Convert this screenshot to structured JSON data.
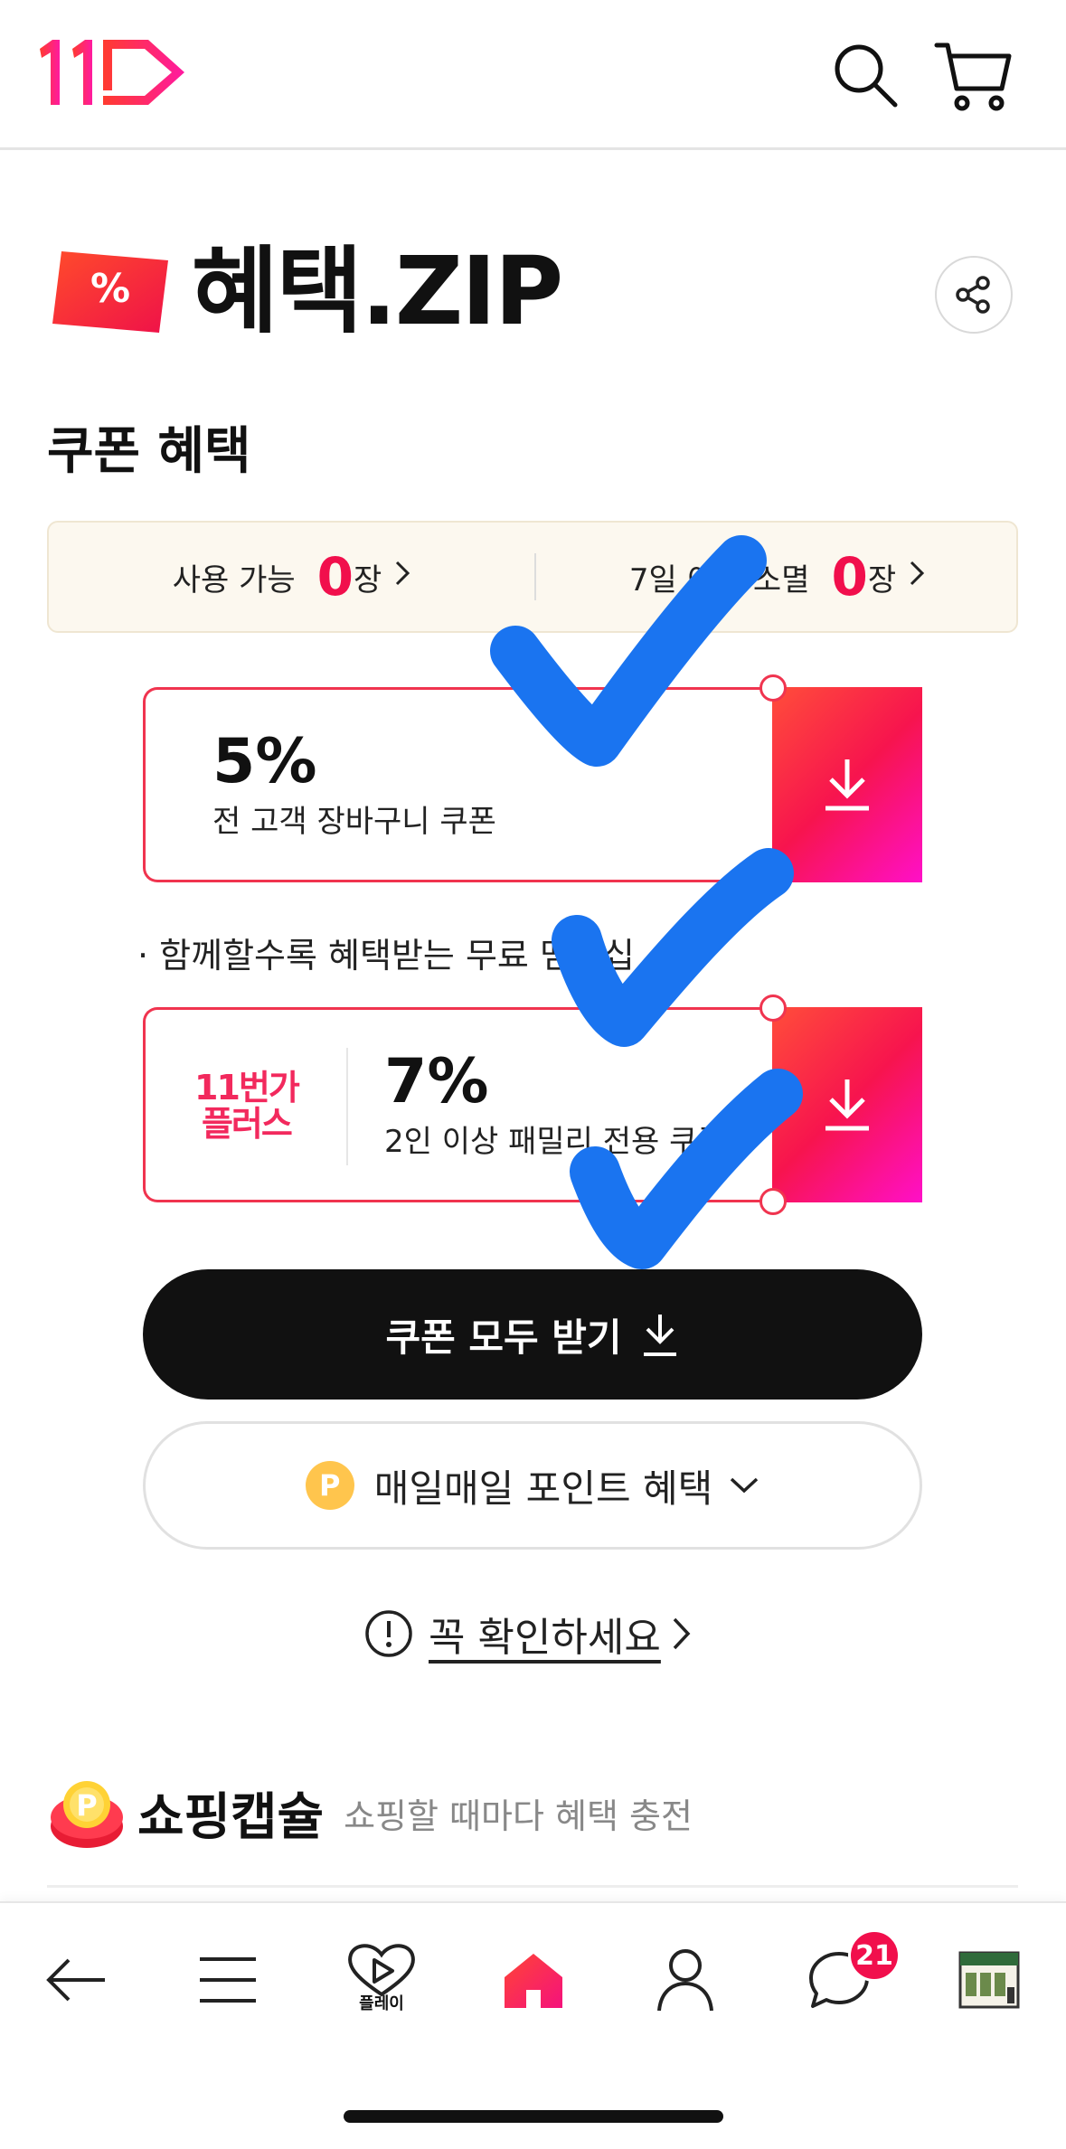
{
  "header": {
    "logo_text": "11",
    "search_icon": "search-icon",
    "cart_icon": "cart-icon"
  },
  "brand": {
    "tag_symbol": "%",
    "title": "혜택.ZIP",
    "share_icon": "share-icon"
  },
  "coupon_section": {
    "title": "쿠폰 혜택",
    "available_label": "사용 가능",
    "available_count": "0",
    "available_unit": "장",
    "expiring_label": "7일 이내 소멸",
    "expiring_count": "0",
    "expiring_unit": "장"
  },
  "coupons": [
    {
      "percent": "5%",
      "description": "전 고객 장바구니 쿠폰"
    },
    {
      "brand_line1": "11번가",
      "brand_line2": "플러스",
      "percent": "7%",
      "description": "2인 이상 패밀리 전용 쿠폰"
    }
  ],
  "plus_note": "· 함께할수록 혜택받는 무료 멤버십",
  "actions": {
    "get_all_label": "쿠폰 모두 받기",
    "points_badge": "P",
    "points_label": "매일매일 포인트 혜택",
    "notice_label": "꼭 확인하세요"
  },
  "capsule": {
    "badge": "P",
    "title": "쇼핑캡슐",
    "subtitle": "쇼핑할 때마다 혜택 충전"
  },
  "bottom_nav": {
    "play_label": "플레이",
    "chat_badge": "21",
    "items": [
      "back-arrow-icon",
      "menu-icon",
      "play-icon",
      "home-icon",
      "profile-icon",
      "chat-icon",
      "recent-product-thumbnail"
    ]
  },
  "colors": {
    "accent": "#f10f4c",
    "gradient_start": "#ff4d3a",
    "gradient_end": "#ff10c8",
    "checkmark": "#1a74f0"
  }
}
